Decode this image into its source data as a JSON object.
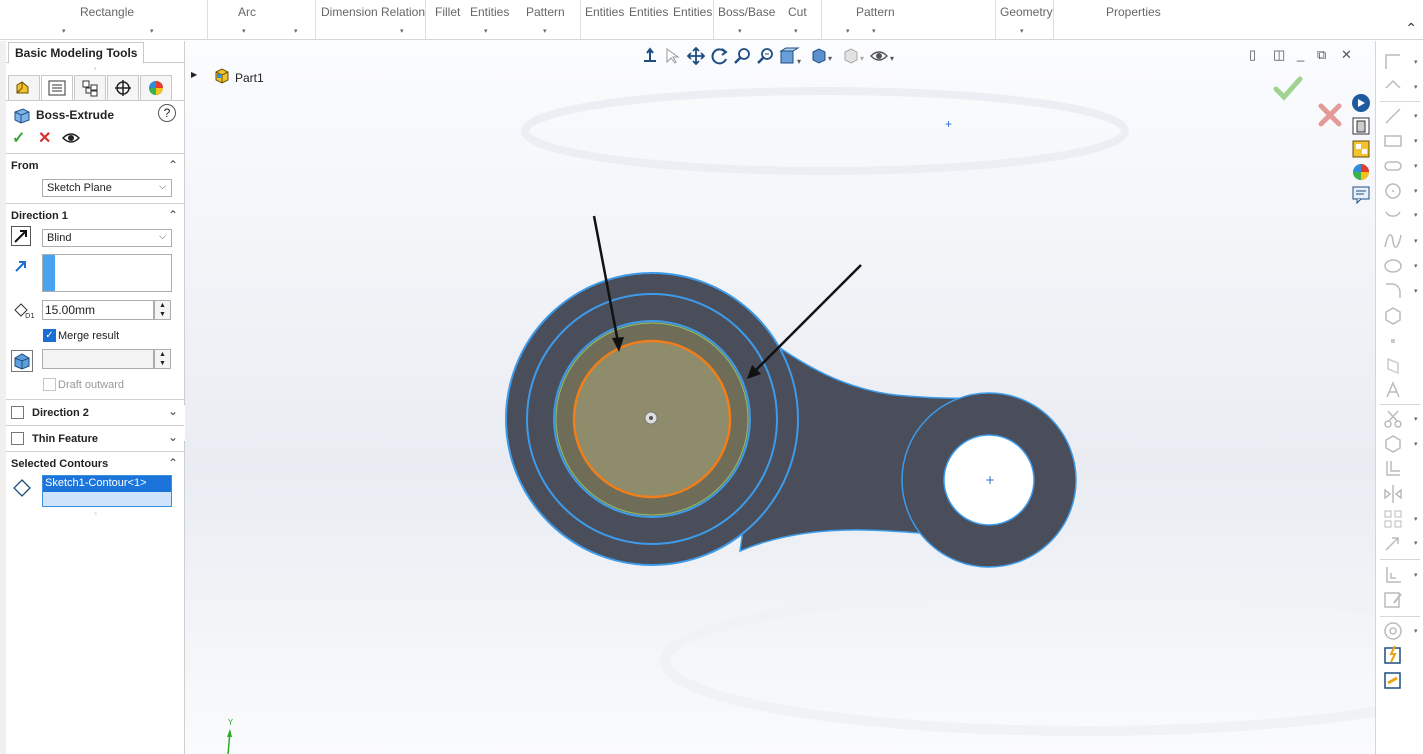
{
  "ribbon": {
    "groups": [
      {
        "label": "Rectangle",
        "caret": true
      },
      {
        "label": "Arc",
        "caret": true
      },
      {
        "label": "Dimension",
        "caret": false
      },
      {
        "label": "Relation",
        "caret": false
      },
      {
        "label": "Fillet",
        "caret": false
      },
      {
        "label": "Entities",
        "caret": true
      },
      {
        "label": "Pattern",
        "caret": true
      },
      {
        "label": "Entities",
        "caret": false
      },
      {
        "label": "Entities",
        "caret": false
      },
      {
        "label": "Entities",
        "caret": false
      },
      {
        "label": "Boss/Base",
        "caret": true
      },
      {
        "label": "Cut",
        "caret": true
      },
      {
        "label": "Pattern",
        "caret": true
      },
      {
        "label": "Geometry",
        "caret": true
      },
      {
        "label": "Properties",
        "caret": false
      }
    ],
    "collapse_icon": "chevron-up-icon"
  },
  "panel": {
    "tab_title": "Basic Modeling Tools",
    "manager_tabs": [
      "feature-manager-icon",
      "property-manager-icon",
      "configuration-manager-icon",
      "dimxpert-icon",
      "display-manager-icon"
    ],
    "feature": {
      "title": "Boss-Extrude",
      "icon": "boss-extrude-icon",
      "help": "?"
    },
    "actions": {
      "ok": "✓",
      "cancel": "✕",
      "preview": "eye-icon"
    },
    "from": {
      "title": "From",
      "value": "Sketch Plane"
    },
    "direction1": {
      "title": "Direction 1",
      "end_condition": "Blind",
      "depth": "15.00mm",
      "depth_icon_label": "D1",
      "merge_result": "Merge result",
      "merge_checked": true,
      "draft_outward": "Draft outward",
      "draft_checked": false
    },
    "direction2": {
      "title": "Direction 2",
      "checked": false
    },
    "thin_feature": {
      "title": "Thin Feature",
      "checked": false
    },
    "selected_contours": {
      "title": "Selected Contours",
      "items": [
        "Sketch1-Contour<1>"
      ]
    }
  },
  "viewport": {
    "tree_label": "Part1",
    "hud_icons": [
      "view-orientation-icon",
      "select-icon",
      "pan-icon",
      "rotate-icon",
      "zoom-to-fit-icon",
      "zoom-area-icon",
      "section-view-icon",
      "view-display-icon",
      "hide-show-icon",
      "appearance-icon"
    ],
    "window_controls": [
      "tile-icon",
      "split-icon",
      "minimize-icon",
      "restore-icon",
      "close-icon"
    ],
    "confirm_icons": {
      "ok": "green-check-icon",
      "cancel": "red-cross-icon"
    },
    "triad_label": "Y"
  },
  "colors": {
    "accent": "#1b6fd2",
    "part_body": "#4a4d5a",
    "edge_highlight": "#3d9be9",
    "selected_face": "#8f8c6c",
    "selected_ring": "#f07e1a",
    "ok_green": "#3aa53a",
    "cancel_red": "#d93030"
  }
}
